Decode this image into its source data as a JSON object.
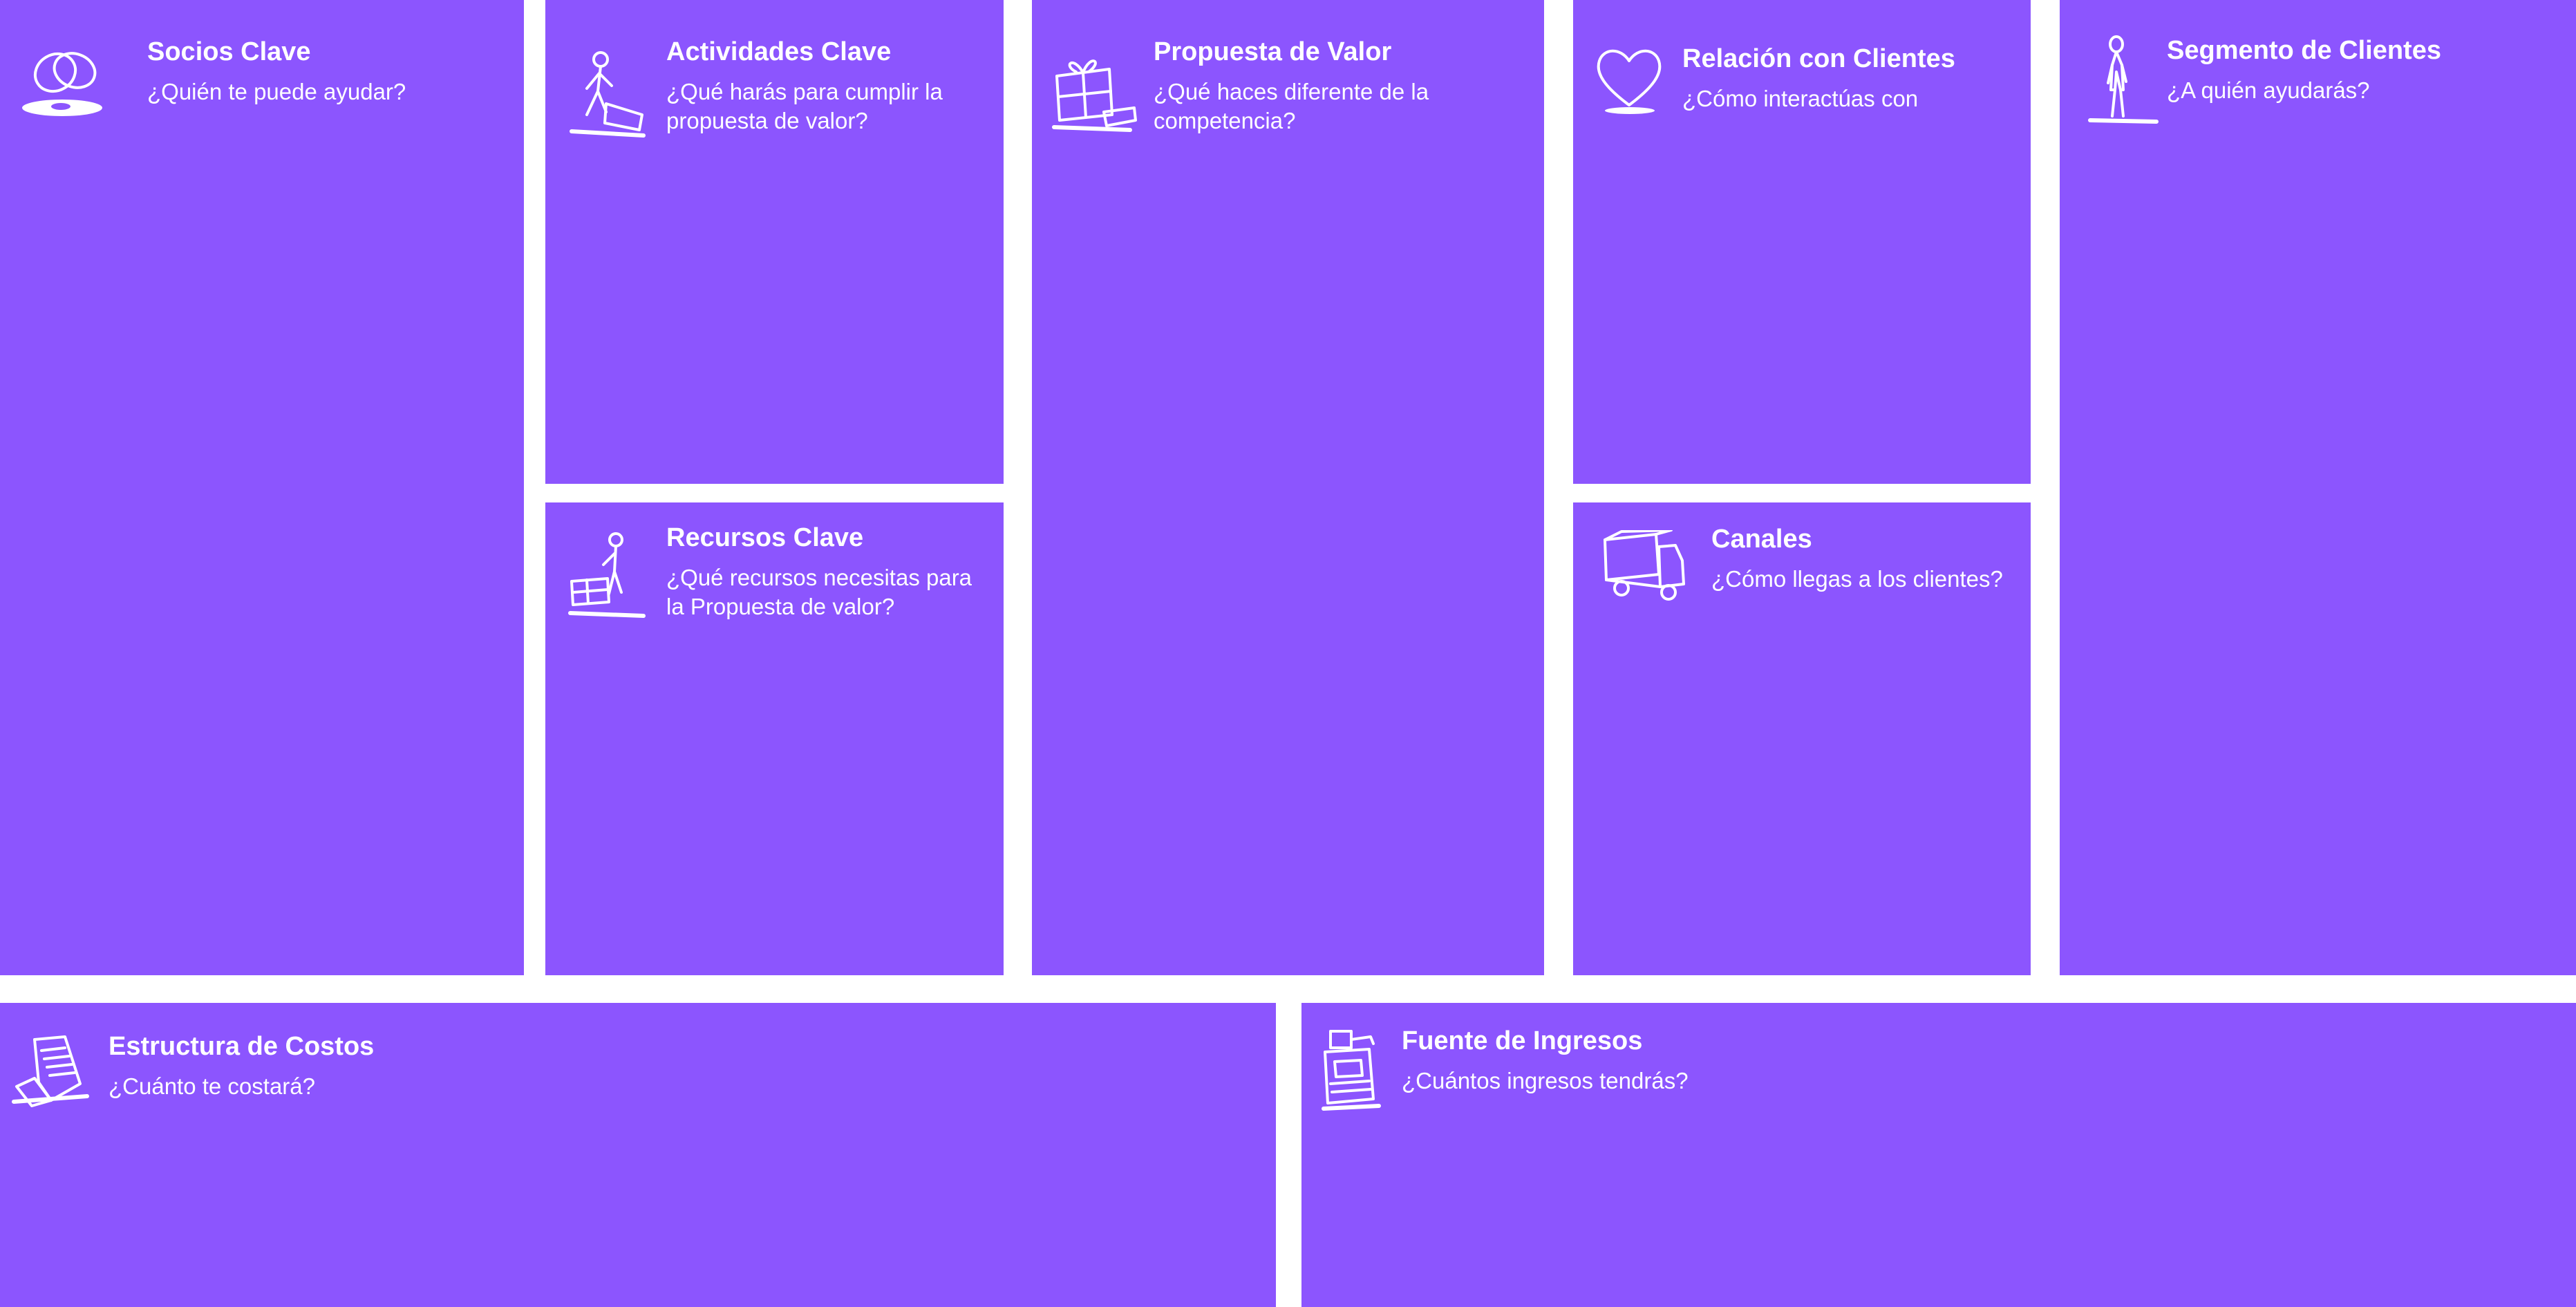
{
  "canvas": {
    "block_color": "#8c55fe",
    "text_color": "#ffffff",
    "background": "#ffffff"
  },
  "blocks": {
    "socios": {
      "title": "Socios Clave",
      "prompt": "¿Quién te puede ayudar?",
      "icon": "rings-icon"
    },
    "actividades": {
      "title": "Actividades Clave",
      "prompt": "¿Qué harás para cumplir la propuesta de valor?",
      "icon": "worker-pushing-icon"
    },
    "recursos": {
      "title": "Recursos Clave",
      "prompt": "¿Qué recursos necesitas para la Propuesta de valor?",
      "icon": "worker-with-boxes-icon"
    },
    "propuesta": {
      "title": "Propuesta de Valor",
      "prompt": "¿Qué haces diferente de la competencia?",
      "icon": "gift-icon"
    },
    "relacion": {
      "title": "Relación con Clientes",
      "prompt": "¿Cómo interactúas con",
      "icon": "heart-icon"
    },
    "canales": {
      "title": "Canales",
      "prompt": "¿Cómo llegas a los clientes?",
      "icon": "truck-icon"
    },
    "segmento": {
      "title": "Segmento de Clientes",
      "prompt": "¿A quién ayudarás?",
      "icon": "person-standing-icon"
    },
    "costos": {
      "title": "Estructura de Costos",
      "prompt": "¿Cuánto te costará?",
      "icon": "receipt-icon"
    },
    "ingresos": {
      "title": "Fuente de Ingresos",
      "prompt": "¿Cuántos ingresos tendrás?",
      "icon": "cash-register-icon"
    }
  }
}
